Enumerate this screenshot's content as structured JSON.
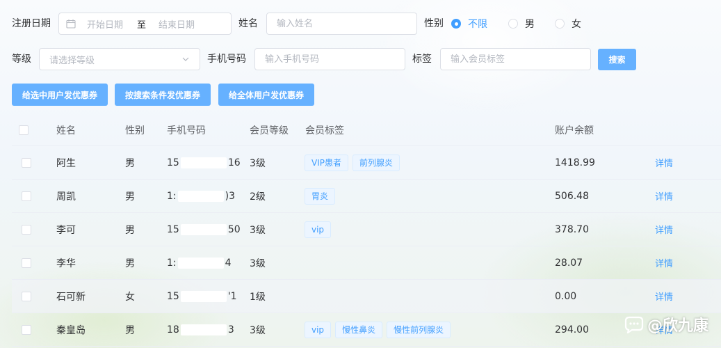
{
  "filters": {
    "reg_date_label": "注册日期",
    "start_placeholder": "开始日期",
    "range_sep": "至",
    "end_placeholder": "结束日期",
    "name_label": "姓名",
    "name_placeholder": "输入姓名",
    "gender_label": "性别",
    "gender_options": [
      "不限",
      "男",
      "女"
    ],
    "gender_selected": "不限",
    "level_label": "等级",
    "level_placeholder": "请选择等级",
    "phone_label": "手机号码",
    "phone_placeholder": "输入手机号码",
    "tag_label": "标签",
    "tag_placeholder": "输入会员标签",
    "search_button": "搜索"
  },
  "actions": {
    "send_selected": "给选中用户发优惠券",
    "send_by_search": "按搜索条件发优惠券",
    "send_all": "给全体用户发优惠券"
  },
  "table": {
    "columns": [
      "姓名",
      "性别",
      "手机号码",
      "会员等级",
      "会员标签",
      "账户余额"
    ],
    "rows": [
      {
        "name": "阿生",
        "gender": "男",
        "phone_start": "15",
        "phone_end": "16",
        "level": "3级",
        "tags": [
          "VIP患者",
          "前列腺炎"
        ],
        "balance": "1418.99",
        "action": "详情"
      },
      {
        "name": "周凯",
        "gender": "男",
        "phone_start": "1:",
        "phone_end": ")3",
        "level": "2级",
        "tags": [
          "胃炎"
        ],
        "balance": "506.48",
        "action": "详情"
      },
      {
        "name": "李可",
        "gender": "男",
        "phone_start": "15",
        "phone_end": "50",
        "level": "3级",
        "tags": [
          "vip"
        ],
        "balance": "378.70",
        "action": "详情"
      },
      {
        "name": "李华",
        "gender": "男",
        "phone_start": "1:",
        "phone_end": "4",
        "level": "3级",
        "tags": [],
        "balance": "28.07",
        "action": "详情"
      },
      {
        "name": "石可新",
        "gender": "女",
        "phone_start": "15",
        "phone_end": "'1",
        "level": "1级",
        "tags": [],
        "balance": "0.00",
        "action": "详情"
      },
      {
        "name": "秦皇岛",
        "gender": "男",
        "phone_start": "18",
        "phone_end": "3",
        "level": "3级",
        "tags": [
          "vip",
          "慢性鼻炎",
          "慢性前列腺炎"
        ],
        "balance": "294.00",
        "action": "详情"
      }
    ]
  },
  "watermark": {
    "text": "@欣九康",
    "icon": "xiaohongshu-logo-icon"
  },
  "colors": {
    "accent": "#409eff",
    "button": "#66b1ff",
    "border": "#dcdfe6",
    "tag_bg": "#ecf5ff"
  }
}
